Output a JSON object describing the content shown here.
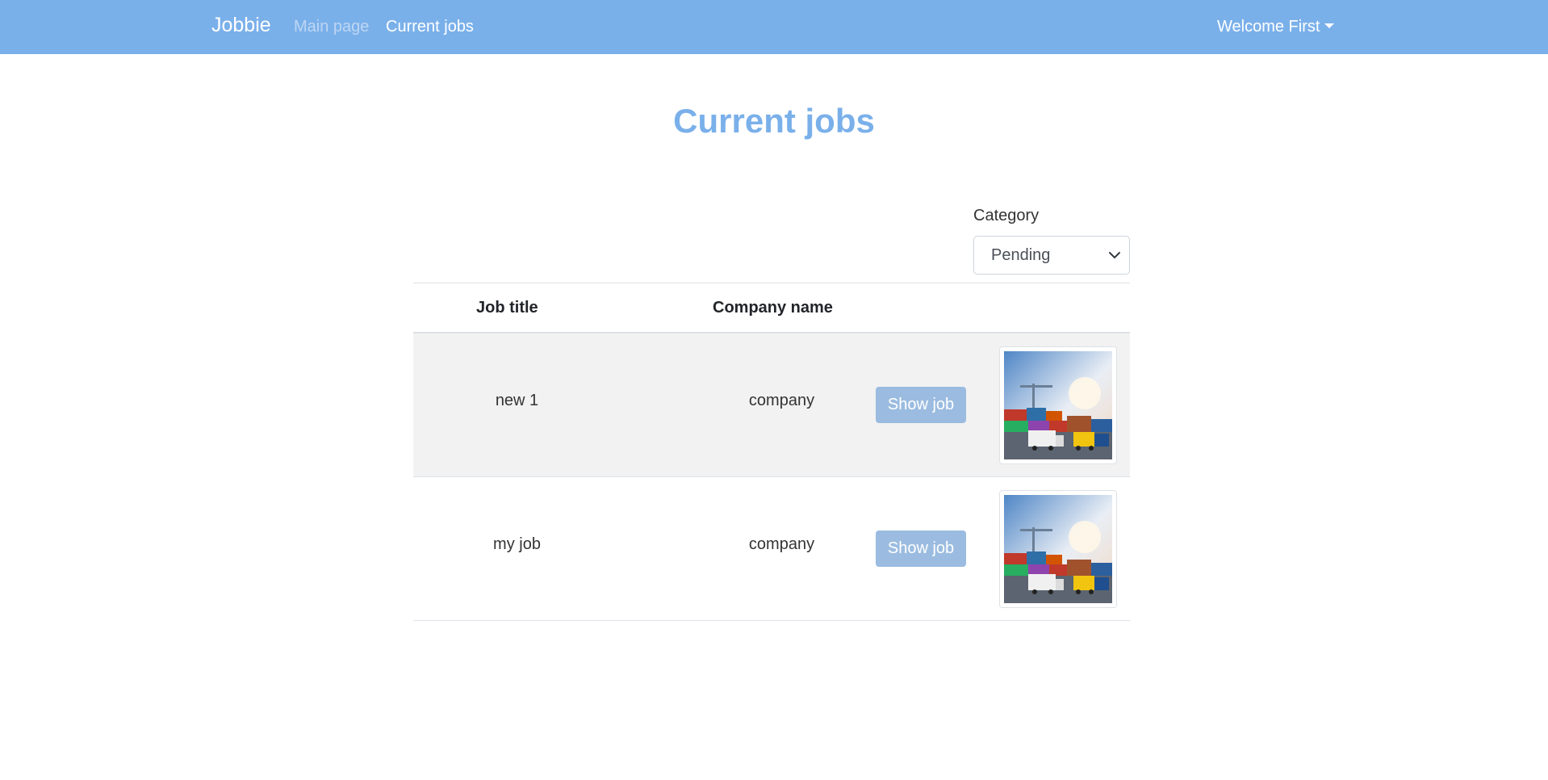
{
  "nav": {
    "brand": "Jobbie",
    "links": [
      "Main page",
      "Current jobs"
    ],
    "user_menu": "Welcome First"
  },
  "page": {
    "title": "Current jobs"
  },
  "filter": {
    "label": "Category",
    "selected": "Pending"
  },
  "table": {
    "headers": [
      "Job title",
      "Company name"
    ],
    "rows": [
      {
        "title": "new 1",
        "company": "company",
        "action": "Show job",
        "image": "cargo-port-photo"
      },
      {
        "title": "my job",
        "company": "company",
        "action": "Show job",
        "image": "cargo-port-photo"
      }
    ]
  },
  "colors": {
    "navbar": "#7ab0ea",
    "title": "#7ab0ea",
    "button": "#9bbce0",
    "stripe": "#f2f2f2"
  }
}
